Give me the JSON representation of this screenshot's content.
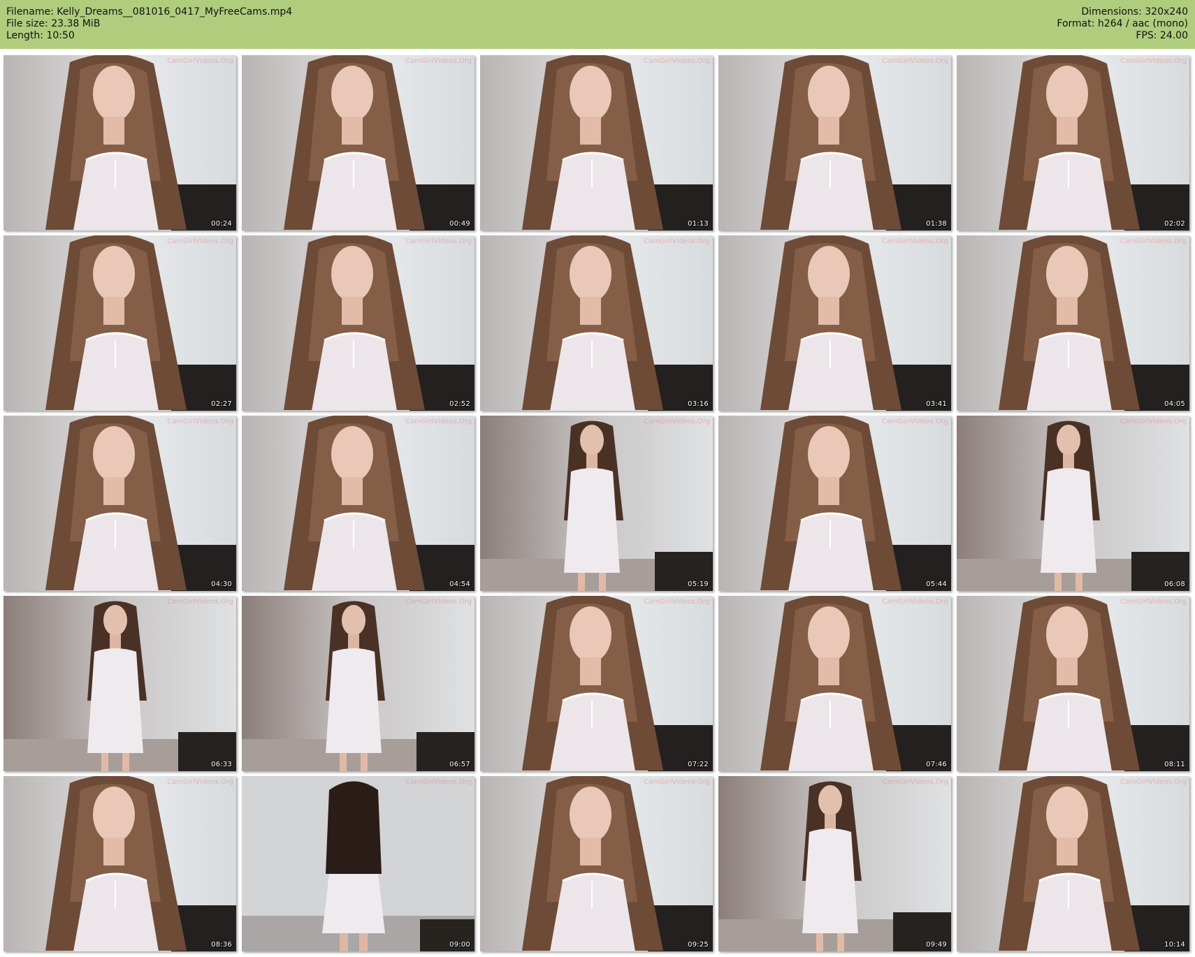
{
  "header": {
    "filename": "Filename: Kelly_Dreams__081016_0417_MyFreeCams.mp4",
    "filesize": "File size: 23.38 MiB",
    "length": "Length: 10:50",
    "dimensions": "Dimensions: 320x240",
    "format": "Format: h264 / aac (mono)",
    "fps": "FPS: 24.00"
  },
  "colors": {
    "header_bg": "#b0cd7e",
    "page_bg": "#ffffff"
  },
  "watermark": "CamGirlVideos.Org",
  "thumbnails": [
    {
      "time": "00:24",
      "scene": "closeup"
    },
    {
      "time": "00:49",
      "scene": "closeup"
    },
    {
      "time": "01:13",
      "scene": "closeup"
    },
    {
      "time": "01:38",
      "scene": "closeup"
    },
    {
      "time": "02:02",
      "scene": "closeup"
    },
    {
      "time": "02:27",
      "scene": "closeup"
    },
    {
      "time": "02:52",
      "scene": "closeup"
    },
    {
      "time": "03:16",
      "scene": "closeup"
    },
    {
      "time": "03:41",
      "scene": "closeup"
    },
    {
      "time": "04:05",
      "scene": "closeup"
    },
    {
      "time": "04:30",
      "scene": "closeup"
    },
    {
      "time": "04:54",
      "scene": "closeup"
    },
    {
      "time": "05:19",
      "scene": "standing"
    },
    {
      "time": "05:44",
      "scene": "closeup"
    },
    {
      "time": "06:08",
      "scene": "standing"
    },
    {
      "time": "06:33",
      "scene": "standing"
    },
    {
      "time": "06:57",
      "scene": "standing"
    },
    {
      "time": "07:22",
      "scene": "closeup"
    },
    {
      "time": "07:46",
      "scene": "closeup"
    },
    {
      "time": "08:11",
      "scene": "closeup"
    },
    {
      "time": "08:36",
      "scene": "closeup"
    },
    {
      "time": "09:00",
      "scene": "back"
    },
    {
      "time": "09:25",
      "scene": "closeup"
    },
    {
      "time": "09:49",
      "scene": "standing"
    },
    {
      "time": "10:14",
      "scene": "closeup"
    }
  ]
}
